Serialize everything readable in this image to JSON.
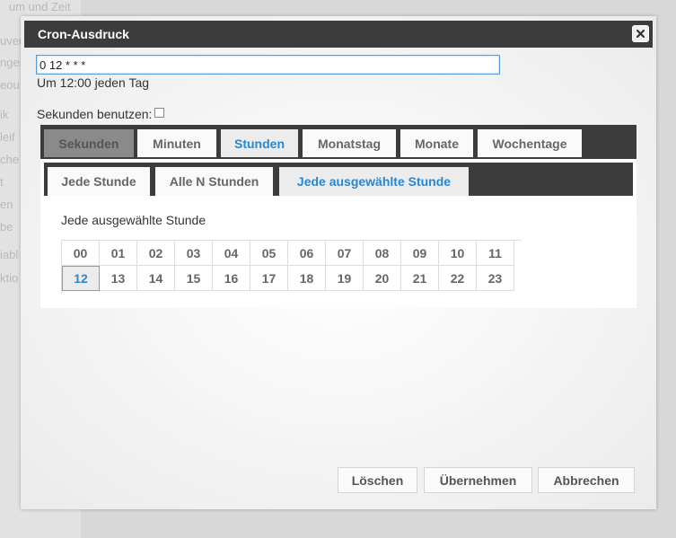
{
  "background": {
    "fragments": [
      "um und Zeit",
      "uver",
      "ngen",
      "eou",
      "ik",
      "leif",
      "che",
      "t",
      "en",
      "be",
      "iabl",
      "ktio"
    ]
  },
  "dialog": {
    "title": "Cron-Ausdruck",
    "close_icon": "close-icon",
    "cron_expression": "0 12 * * *",
    "description": "Um 12:00 jeden Tag",
    "seconds_label": "Sekunden benutzen:",
    "seconds_checked": false
  },
  "outer_tabs": {
    "items": [
      {
        "label": "Sekunden",
        "state": "disabled"
      },
      {
        "label": "Minuten",
        "state": "normal"
      },
      {
        "label": "Stunden",
        "state": "active"
      },
      {
        "label": "Monatstag",
        "state": "normal"
      },
      {
        "label": "Monate",
        "state": "normal"
      },
      {
        "label": "Wochentage",
        "state": "normal"
      }
    ]
  },
  "inner_tabs": {
    "items": [
      {
        "label": "Jede Stunde",
        "state": "normal"
      },
      {
        "label": "Alle N Stunden",
        "state": "normal"
      },
      {
        "label": "Jede ausgewählte Stunde",
        "state": "active"
      }
    ]
  },
  "panel": {
    "hint": "Jede ausgewählte Stunde",
    "hours": [
      "00",
      "01",
      "02",
      "03",
      "04",
      "05",
      "06",
      "07",
      "08",
      "09",
      "10",
      "11",
      "12",
      "13",
      "14",
      "15",
      "16",
      "17",
      "18",
      "19",
      "20",
      "21",
      "22",
      "23"
    ],
    "selected_hour": "12"
  },
  "footer": {
    "delete_label": "Löschen",
    "apply_label": "Übernehmen",
    "cancel_label": "Abbrechen"
  },
  "colors": {
    "accent": "#2a87cf",
    "titlebar": "#3c3c3c"
  }
}
